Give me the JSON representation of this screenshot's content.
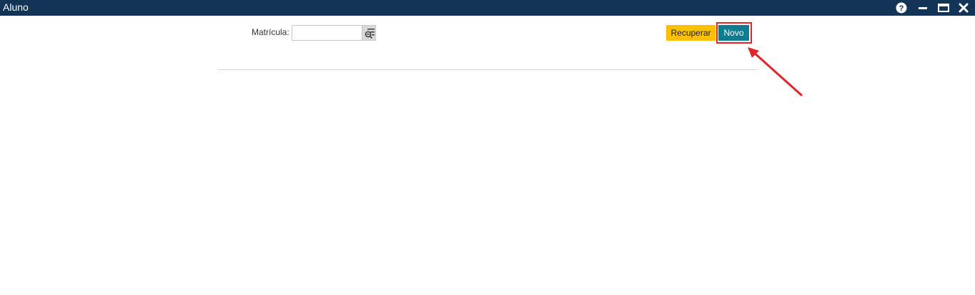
{
  "window": {
    "title": "Aluno",
    "controls": {
      "help": "?"
    }
  },
  "form": {
    "matricula_label": "Matrícula:",
    "matricula_value": "",
    "matricula_placeholder": ""
  },
  "actions": {
    "recuperar_label": "Recuperar",
    "novo_label": "Novo"
  },
  "colors": {
    "titlebar": "#123456",
    "recuperar": "#ffc000",
    "novo": "#0f7b8e",
    "annotation": "#e0262b"
  }
}
